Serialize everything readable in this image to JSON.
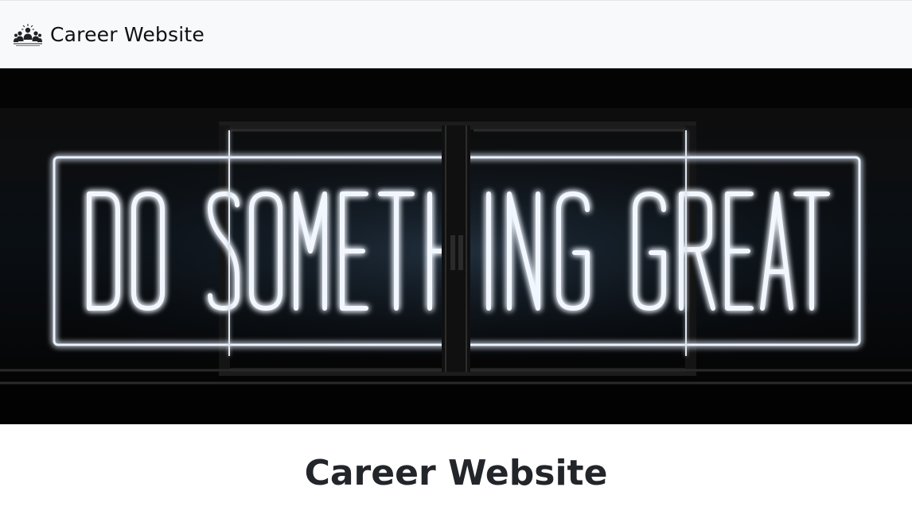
{
  "navbar": {
    "brand_text": "Career Website",
    "logo_icon": "people-group-icon"
  },
  "banner": {
    "sign_text": "DO SOMETHING GREAT",
    "image_subject": "neon sign behind window",
    "neon_color": "#eef4ff"
  },
  "main": {
    "title": "Career Website"
  },
  "colors": {
    "navbar_bg": "#f8f9fa",
    "title_text": "#222529",
    "banner_bg": "#050505"
  }
}
